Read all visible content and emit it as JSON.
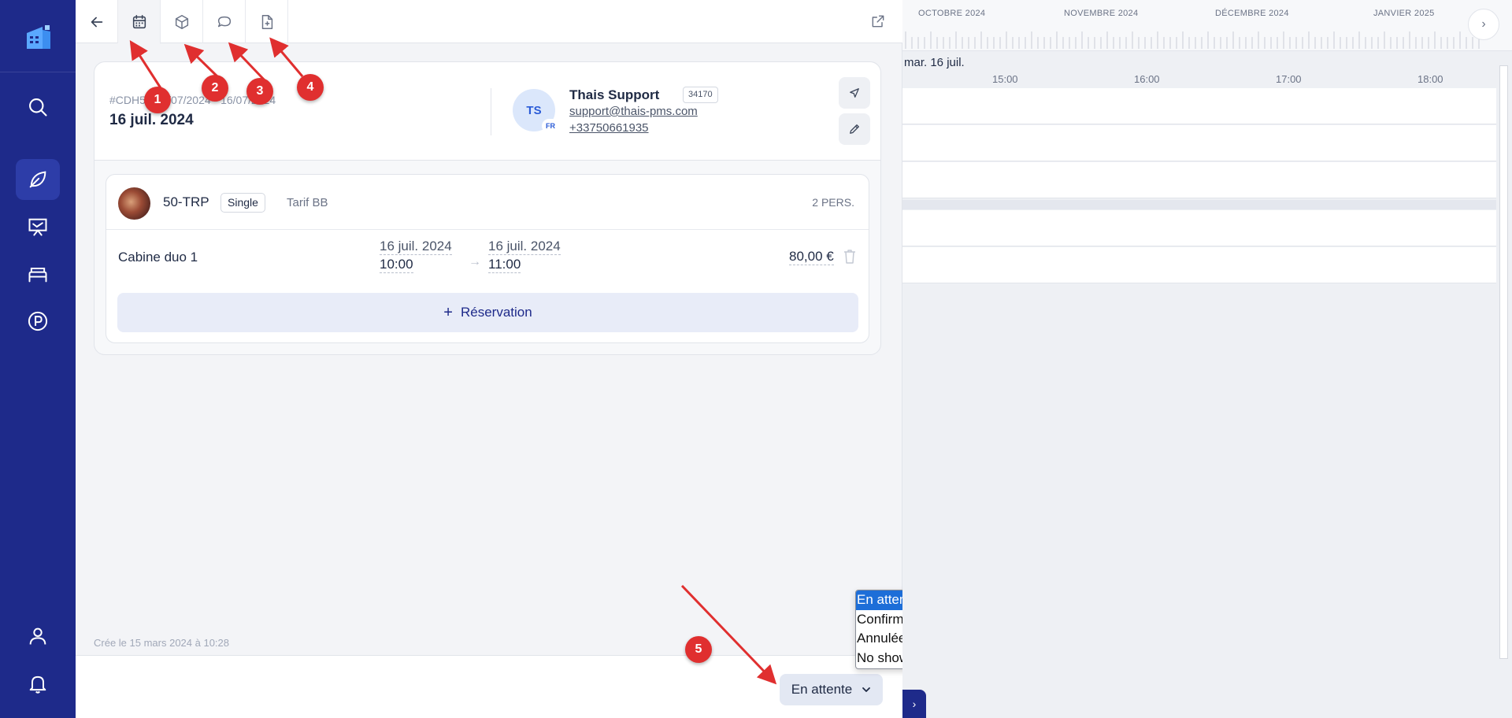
{
  "sidebar": {
    "items": [
      {
        "name": "search",
        "icon": "search-icon"
      },
      {
        "name": "activity",
        "icon": "leaf-icon",
        "active": true
      },
      {
        "name": "presentation",
        "icon": "board-icon"
      },
      {
        "name": "rooms",
        "icon": "bed-icon"
      },
      {
        "name": "parking",
        "icon": "parking-icon"
      },
      {
        "name": "account",
        "icon": "user-icon"
      },
      {
        "name": "notifications",
        "icon": "bell-icon"
      }
    ]
  },
  "tabs": [
    {
      "icon": "back-arrow-icon"
    },
    {
      "icon": "calendar-icon",
      "active": true
    },
    {
      "icon": "cube-icon"
    },
    {
      "icon": "chat-icon"
    },
    {
      "icon": "file-add-icon"
    }
  ],
  "reservation": {
    "id_line": "#CDH5 • 16/07/2024 - 16/07/2024",
    "date": "16 juil. 2024"
  },
  "guest": {
    "initials": "TS",
    "flag": "FR",
    "name": "Thais Support",
    "badge": "34170",
    "email": "support@thais-pms.com",
    "phone": "+33750661935"
  },
  "room": {
    "code": "50-TRP",
    "type": "Single",
    "tarif": "Tarif BB",
    "persons": "2 PERS.",
    "line": {
      "name": "Cabine duo 1",
      "start_date": "16 juil. 2024",
      "start_time": "10:00",
      "end_date": "16 juil. 2024",
      "end_time": "11:00",
      "price": "80,00 €"
    },
    "add_label": "Réservation"
  },
  "created": "Crée le 15 mars 2024 à 10:28",
  "status": {
    "current": "En attente",
    "options": [
      "En attente",
      "Confirmée",
      "Annulée",
      "No show"
    ]
  },
  "timeline": {
    "months": [
      "OCTOBRE 2024",
      "NOVEMBRE 2024",
      "DÉCEMBRE 2024",
      "JANVIER 2025"
    ],
    "day": "mar. 16 juil.",
    "hours": [
      "15:00",
      "16:00",
      "17:00",
      "18:00"
    ]
  },
  "annotations": [
    "1",
    "2",
    "3",
    "4",
    "5"
  ],
  "colors": {
    "sidebar": "#1e2a8a",
    "accent": "#2a5bd7",
    "annotation": "#e02f2f",
    "dropdown_selected": "#1d6ed8"
  }
}
